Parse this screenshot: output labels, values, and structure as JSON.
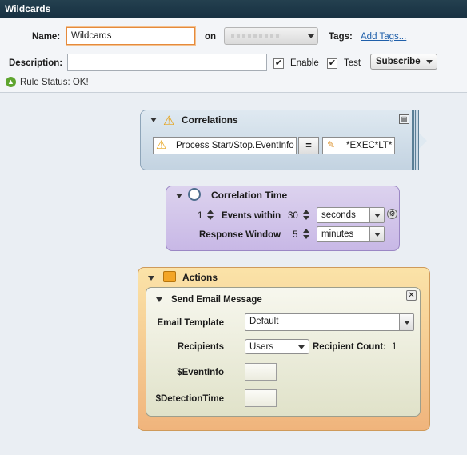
{
  "window": {
    "title": "Wildcards"
  },
  "form": {
    "name_label": "Name:",
    "name_value": "Wildcards",
    "on_label": "on",
    "tags_label": "Tags:",
    "add_tags_link": "Add Tags...",
    "description_label": "Description:",
    "description_value": "",
    "enable_label": "Enable",
    "enable_checked": "✔",
    "test_label": "Test",
    "test_checked": "✔",
    "subscribe_label": "Subscribe",
    "rule_status": "Rule Status: OK!"
  },
  "correlations": {
    "title": "Correlations",
    "condition_field": "Process Start/Stop.EventInfo",
    "operator": "=",
    "value": "*EXEC*LT*"
  },
  "correlation_time": {
    "title": "Correlation Time",
    "count": "1",
    "events_within_label": "Events within",
    "window_value": "30",
    "window_unit": "seconds",
    "response_window_label": "Response Window",
    "response_value": "5",
    "response_unit": "minutes"
  },
  "actions": {
    "title": "Actions",
    "email": {
      "title": "Send Email Message",
      "template_label": "Email Template",
      "template_value": "Default",
      "recipients_label": "Recipients",
      "recipients_value": "Users",
      "recipient_count_label": "Recipient Count:",
      "recipient_count": "1",
      "eventinfo_label": "$EventInfo",
      "detectiontime_label": "$DetectionTime"
    }
  },
  "colors": {
    "titlebar": "#1c3646",
    "correlations_bg": "#d0dde8",
    "correlation_time_bg": "#d6c9ec",
    "actions_bg": "#f5c690",
    "email_bg": "#e6e8d4",
    "focus_border": "#e58a3c"
  }
}
